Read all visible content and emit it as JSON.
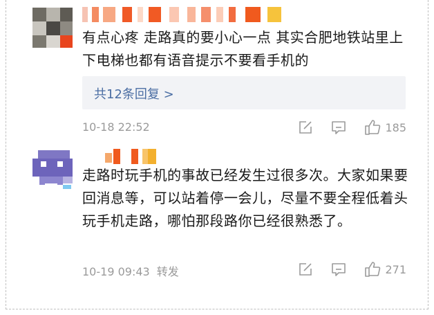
{
  "comments": [
    {
      "text": "有点心疼  走路真的要小心一点  其实合肥地铁站里上下电梯也都有语音提示不要看手机的",
      "replies_label": "共12条回复 >",
      "time": "10-18 22:52",
      "tag": "",
      "likes": "185"
    },
    {
      "text": "走路时玩手机的事故已经发生过很多次。大家如果要回消息等，可以站着停一会儿，尽量不要全程低着头玩手机走路，哪怕那段路你已经很熟悉了。",
      "time": "10-19 09:43",
      "tag": "转发",
      "likes": "271"
    }
  ],
  "icons": {
    "edit": "edit-icon",
    "reply": "comment-icon",
    "like": "thumbs-up-icon"
  },
  "colors": {
    "link": "#4a6da3",
    "meta": "#9a9a9a",
    "reply_bg": "#f2f3f6"
  }
}
